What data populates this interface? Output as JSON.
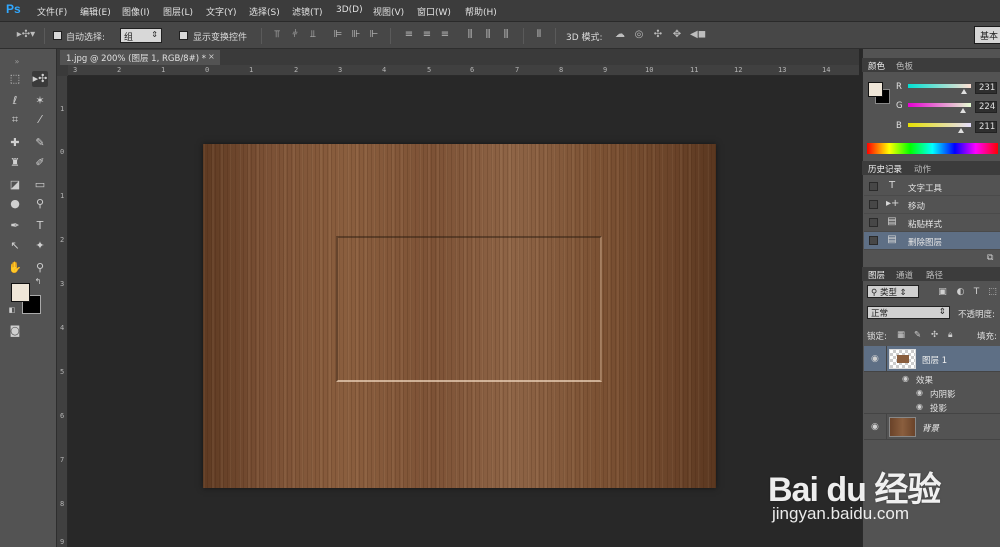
{
  "app": {
    "logo": "Ps"
  },
  "menu": [
    "文件(F)",
    "编辑(E)",
    "图像(I)",
    "图层(L)",
    "文字(Y)",
    "选择(S)",
    "滤镜(T)",
    "3D(D)",
    "视图(V)",
    "窗口(W)",
    "帮助(H)"
  ],
  "options": {
    "auto_select_label": "自动选择:",
    "auto_select_value": "组",
    "show_transform_label": "显示变换控件",
    "mode_3d_label": "3D 模式:",
    "workspace_label": "基本"
  },
  "document": {
    "tab_title": "1.jpg @ 200% (图层 1, RGB/8#) *",
    "close_glyph": "×"
  },
  "rulers": {
    "h_ticks": [
      "3",
      "2",
      "1",
      "0",
      "1",
      "2",
      "3",
      "4",
      "5",
      "6",
      "7",
      "8",
      "9",
      "10",
      "11",
      "12",
      "13",
      "14"
    ],
    "v_ticks": [
      "1",
      "0",
      "1",
      "2",
      "3",
      "4",
      "5",
      "6",
      "7",
      "8",
      "9"
    ]
  },
  "color_panel": {
    "tabs": [
      "颜色",
      "色板"
    ],
    "r_label": "R",
    "r_value": "231",
    "g_label": "G",
    "g_value": "224",
    "b_label": "B",
    "b_value": "211",
    "fg_color": "#e7e0d3",
    "bg_color": "#000000"
  },
  "history_panel": {
    "tabs": [
      "历史记录",
      "动作"
    ],
    "items": [
      {
        "icon": "T",
        "label": "文字工具"
      },
      {
        "icon": "▸+",
        "label": "移动"
      },
      {
        "icon": "▤",
        "label": "粘贴样式"
      },
      {
        "icon": "▤",
        "label": "删除图层"
      }
    ]
  },
  "layers_panel": {
    "tabs": [
      "图层",
      "通道",
      "路径"
    ],
    "filter_label": "类型",
    "blend_mode": "正常",
    "opacity_label": "不透明度:",
    "lock_label": "锁定:",
    "fill_label": "填充:",
    "layers": [
      {
        "name": "图层 1",
        "effects_label": "效果",
        "effects": [
          "内阴影",
          "投影"
        ]
      },
      {
        "name": "背景"
      }
    ]
  },
  "watermark": {
    "brand": "Bai du 经验",
    "url": "jingyan.baidu.com"
  }
}
